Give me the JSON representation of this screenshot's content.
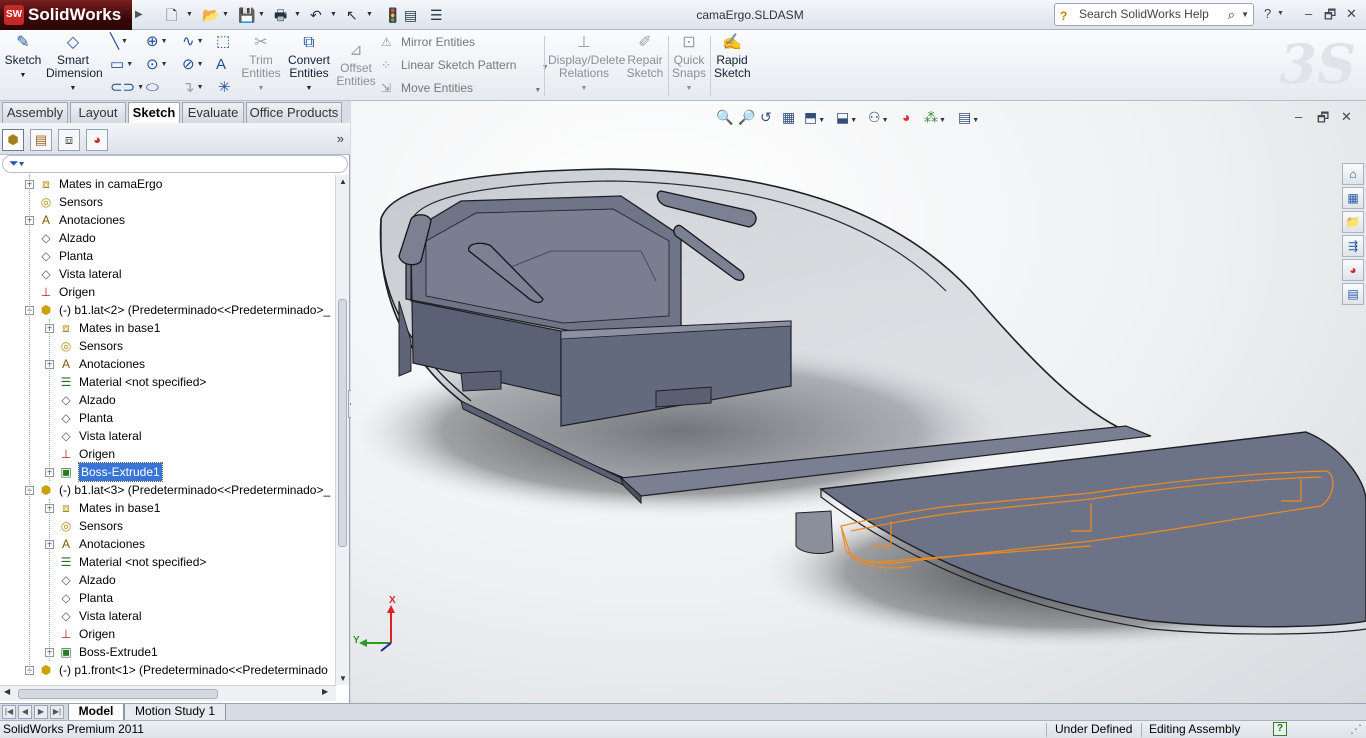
{
  "app": {
    "name": "SolidWorks",
    "logo_short": "SW",
    "document_title": "camaErgo.SLDASM"
  },
  "titlebar": {
    "help_search_placeholder": "Search SolidWorks Help",
    "help_icon": "?",
    "window_buttons": [
      "–",
      "🗗",
      "✕"
    ]
  },
  "quick_access": [
    {
      "name": "new-icon",
      "glyph": "🗋"
    },
    {
      "name": "open-icon",
      "glyph": "📂"
    },
    {
      "name": "save-icon",
      "glyph": "💾"
    },
    {
      "name": "print-icon",
      "glyph": "🖶"
    },
    {
      "name": "undo-icon",
      "glyph": "↶"
    },
    {
      "name": "select-icon",
      "glyph": "↖"
    },
    {
      "name": "rebuild-icon",
      "glyph": "🚦"
    },
    {
      "name": "file-properties-icon",
      "glyph": "▤"
    },
    {
      "name": "options-icon",
      "glyph": "☰"
    }
  ],
  "commandmanager": {
    "sketch": "Sketch",
    "smart_dimension": [
      "Smart",
      "Dimension"
    ],
    "trim_entities": [
      "Trim",
      "Entities"
    ],
    "convert_entities": [
      "Convert",
      "Entities"
    ],
    "offset_entities": [
      "Offset",
      "Entities"
    ],
    "mirror_entities": "Mirror Entities",
    "linear_sketch_pattern": "Linear Sketch Pattern",
    "move_entities": "Move Entities",
    "display_delete_relations": [
      "Display/Delete",
      "Relations"
    ],
    "repair_sketch": [
      "Repair",
      "Sketch"
    ],
    "quick_snaps": [
      "Quick",
      "Snaps"
    ],
    "rapid_sketch": [
      "Rapid",
      "Sketch"
    ]
  },
  "tabs": [
    {
      "label": "Assembly",
      "active": false
    },
    {
      "label": "Layout",
      "active": false
    },
    {
      "label": "Sketch",
      "active": true
    },
    {
      "label": "Evaluate",
      "active": false
    },
    {
      "label": "Office Products",
      "active": false
    }
  ],
  "feature_tree": [
    {
      "label": "Mates in camaErgo",
      "icon": "mates-icon",
      "level": 1,
      "expandable": true
    },
    {
      "label": "Sensors",
      "icon": "sensors-icon",
      "level": 1,
      "expandable": false
    },
    {
      "label": "Anotaciones",
      "icon": "annotations-icon",
      "level": 1,
      "expandable": true
    },
    {
      "label": "Alzado",
      "icon": "plane-icon",
      "level": 1,
      "expandable": false
    },
    {
      "label": "Planta",
      "icon": "plane-icon",
      "level": 1,
      "expandable": false
    },
    {
      "label": "Vista lateral",
      "icon": "plane-icon",
      "level": 1,
      "expandable": false
    },
    {
      "label": "Origen",
      "icon": "origin-icon",
      "level": 1,
      "expandable": false
    },
    {
      "label": "(-) b1.lat<2> (Predeterminado<<Predeterminado>_",
      "icon": "part-icon",
      "level": 1,
      "expandable": true,
      "expanded": true
    },
    {
      "label": "Mates in base1",
      "icon": "mates-icon",
      "level": 2,
      "expandable": true
    },
    {
      "label": "Sensors",
      "icon": "sensors-icon",
      "level": 2,
      "expandable": false
    },
    {
      "label": "Anotaciones",
      "icon": "annotations-icon",
      "level": 2,
      "expandable": true
    },
    {
      "label": "Material <not specified>",
      "icon": "material-icon",
      "level": 2,
      "expandable": false
    },
    {
      "label": "Alzado",
      "icon": "plane-icon",
      "level": 2,
      "expandable": false
    },
    {
      "label": "Planta",
      "icon": "plane-icon",
      "level": 2,
      "expandable": false
    },
    {
      "label": "Vista lateral",
      "icon": "plane-icon",
      "level": 2,
      "expandable": false
    },
    {
      "label": "Origen",
      "icon": "origin-icon",
      "level": 2,
      "expandable": false
    },
    {
      "label": "Boss-Extrude1",
      "icon": "extrude-icon",
      "level": 2,
      "expandable": true,
      "selected": true
    },
    {
      "label": "(-) b1.lat<3> (Predeterminado<<Predeterminado>_",
      "icon": "part-icon",
      "level": 1,
      "expandable": true,
      "expanded": true
    },
    {
      "label": "Mates in base1",
      "icon": "mates-icon",
      "level": 2,
      "expandable": true
    },
    {
      "label": "Sensors",
      "icon": "sensors-icon",
      "level": 2,
      "expandable": false
    },
    {
      "label": "Anotaciones",
      "icon": "annotations-icon",
      "level": 2,
      "expandable": true
    },
    {
      "label": "Material <not specified>",
      "icon": "material-icon",
      "level": 2,
      "expandable": false
    },
    {
      "label": "Alzado",
      "icon": "plane-icon",
      "level": 2,
      "expandable": false
    },
    {
      "label": "Planta",
      "icon": "plane-icon",
      "level": 2,
      "expandable": false
    },
    {
      "label": "Vista lateral",
      "icon": "plane-icon",
      "level": 2,
      "expandable": false
    },
    {
      "label": "Origen",
      "icon": "origin-icon",
      "level": 2,
      "expandable": false
    },
    {
      "label": "Boss-Extrude1",
      "icon": "extrude-icon",
      "level": 2,
      "expandable": true
    },
    {
      "label": "(-) p1.front<1> (Predeterminado<<Predeterminado",
      "icon": "part-icon",
      "level": 1,
      "expandable": true,
      "expanded": true
    }
  ],
  "triad": {
    "x_label": "X",
    "y_label": "Y"
  },
  "bottom_tabs": [
    {
      "label": "Model",
      "active": true
    },
    {
      "label": "Motion Study 1",
      "active": false
    }
  ],
  "status": {
    "product": "SolidWorks Premium 2011",
    "definition": "Under Defined",
    "mode": "Editing Assembly",
    "help": "?"
  },
  "colors": {
    "selection": "#3875d7",
    "model_body": "#6f7587",
    "sketch_highlight": "#f08a1c",
    "brand_red": "#c62828"
  }
}
